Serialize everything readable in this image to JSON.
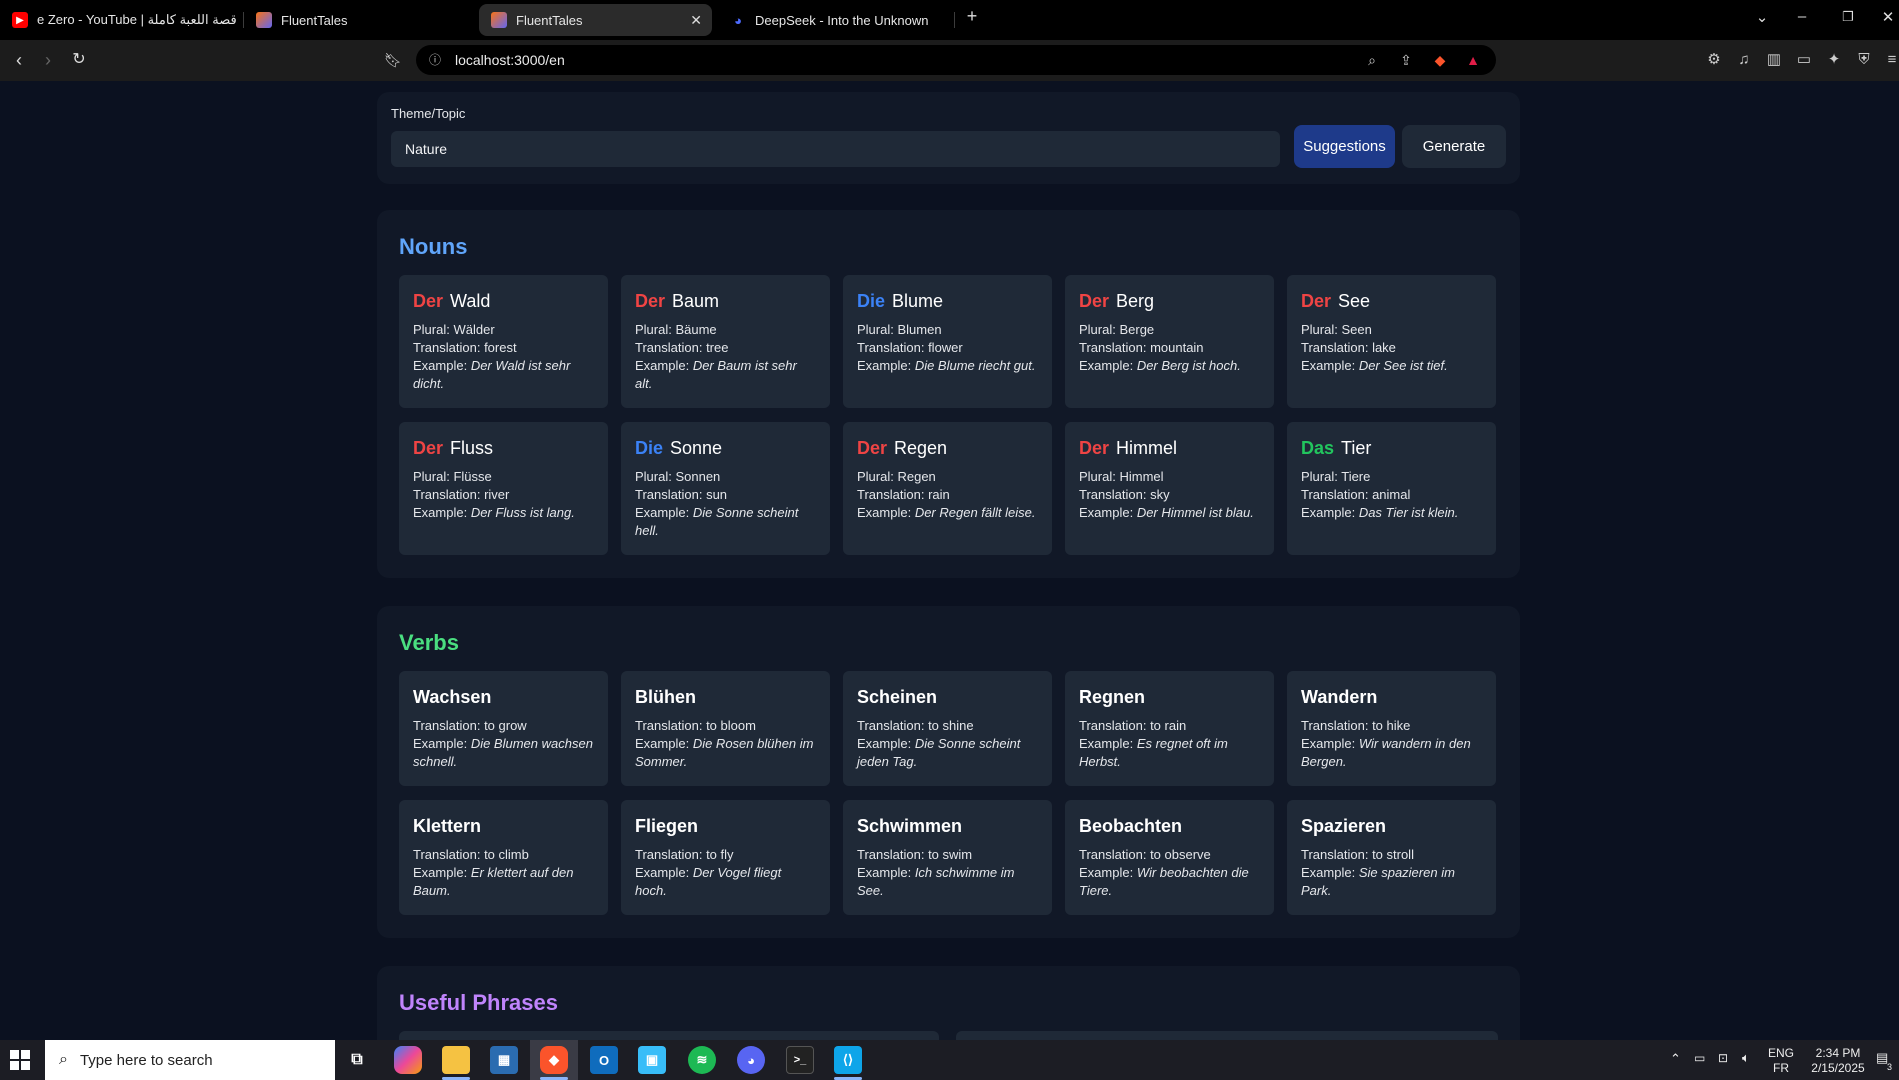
{
  "browser": {
    "tabs": [
      {
        "title": "e Zero - YouTube | قصة اللعبة كاملة",
        "icon": "youtube-icon"
      },
      {
        "title": "FluentTales",
        "icon": "fluenttales-icon"
      },
      {
        "title": "FluentTales",
        "icon": "fluenttales-icon",
        "active": true
      },
      {
        "title": "DeepSeek - Into the Unknown",
        "icon": "deepseek-icon"
      }
    ],
    "url": "localhost:3000/en"
  },
  "form": {
    "theme_label": "Theme/Topic",
    "theme_value": "Nature",
    "suggestions_label": "Suggestions",
    "generate_label": "Generate"
  },
  "labels": {
    "plural": "Plural: ",
    "translation": "Translation: ",
    "example": "Example: "
  },
  "nouns": {
    "title": "Nouns",
    "items": [
      {
        "article": "Der",
        "word": "Wald",
        "plural": "Wälder",
        "translation": "forest",
        "example": "Der Wald ist sehr dicht."
      },
      {
        "article": "Der",
        "word": "Baum",
        "plural": "Bäume",
        "translation": "tree",
        "example": "Der Baum ist sehr alt."
      },
      {
        "article": "Die",
        "word": "Blume",
        "plural": "Blumen",
        "translation": "flower",
        "example": "Die Blume riecht gut."
      },
      {
        "article": "Der",
        "word": "Berg",
        "plural": "Berge",
        "translation": "mountain",
        "example": "Der Berg ist hoch."
      },
      {
        "article": "Der",
        "word": "See",
        "plural": "Seen",
        "translation": "lake",
        "example": "Der See ist tief."
      },
      {
        "article": "Der",
        "word": "Fluss",
        "plural": "Flüsse",
        "translation": "river",
        "example": "Der Fluss ist lang."
      },
      {
        "article": "Die",
        "word": "Sonne",
        "plural": "Sonnen",
        "translation": "sun",
        "example": "Die Sonne scheint hell."
      },
      {
        "article": "Der",
        "word": "Regen",
        "plural": "Regen",
        "translation": "rain",
        "example": "Der Regen fällt leise."
      },
      {
        "article": "Der",
        "word": "Himmel",
        "plural": "Himmel",
        "translation": "sky",
        "example": "Der Himmel ist blau."
      },
      {
        "article": "Das",
        "word": "Tier",
        "plural": "Tiere",
        "translation": "animal",
        "example": "Das Tier ist klein."
      }
    ]
  },
  "verbs": {
    "title": "Verbs",
    "items": [
      {
        "word": "Wachsen",
        "translation": "to grow",
        "example": "Die Blumen wachsen schnell."
      },
      {
        "word": "Blühen",
        "translation": "to bloom",
        "example": "Die Rosen blühen im Sommer."
      },
      {
        "word": "Scheinen",
        "translation": "to shine",
        "example": "Die Sonne scheint jeden Tag."
      },
      {
        "word": "Regnen",
        "translation": "to rain",
        "example": "Es regnet oft im Herbst."
      },
      {
        "word": "Wandern",
        "translation": "to hike",
        "example": "Wir wandern in den Bergen."
      },
      {
        "word": "Klettern",
        "translation": "to climb",
        "example": "Er klettert auf den Baum."
      },
      {
        "word": "Fliegen",
        "translation": "to fly",
        "example": "Der Vogel fliegt hoch."
      },
      {
        "word": "Schwimmen",
        "translation": "to swim",
        "example": "Ich schwimme im See."
      },
      {
        "word": "Beobachten",
        "translation": "to observe",
        "example": "Wir beobachten die Tiere."
      },
      {
        "word": "Spazieren",
        "translation": "to stroll",
        "example": "Sie spazieren im Park."
      }
    ]
  },
  "phrases": {
    "title": "Useful Phrases"
  },
  "colors": {
    "der": "#ef4444",
    "die": "#3b82f6",
    "das": "#22c55e",
    "nouns_title": "#60a5fa",
    "verbs_title": "#4ade80",
    "phrases_title": "#c084fc"
  },
  "taskbar": {
    "search_placeholder": "Type here to search",
    "lang_top": "ENG",
    "lang_bottom": "FR",
    "time": "2:34 PM",
    "date": "2/15/2025",
    "notification_count": "3"
  }
}
